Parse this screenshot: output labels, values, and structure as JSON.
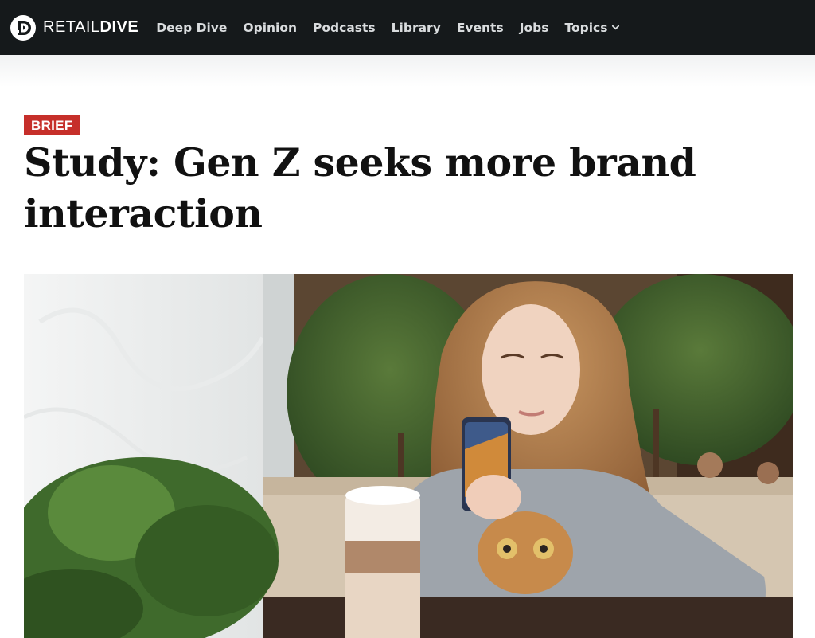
{
  "brand": {
    "name_light": "RETAIL",
    "name_bold": "DIVE"
  },
  "nav": {
    "items": [
      {
        "label": "Deep Dive"
      },
      {
        "label": "Opinion"
      },
      {
        "label": "Podcasts"
      },
      {
        "label": "Library"
      },
      {
        "label": "Events"
      },
      {
        "label": "Jobs"
      },
      {
        "label": "Topics"
      }
    ]
  },
  "article": {
    "badge": "BRIEF",
    "title": "Study: Gen Z seeks more brand interaction"
  },
  "colors": {
    "nav_background": "#15191b",
    "badge_red": "#c62f2a",
    "text": "#111111"
  },
  "icons": [
    "retail-dive-logo-icon",
    "chevron-down-icon"
  ]
}
